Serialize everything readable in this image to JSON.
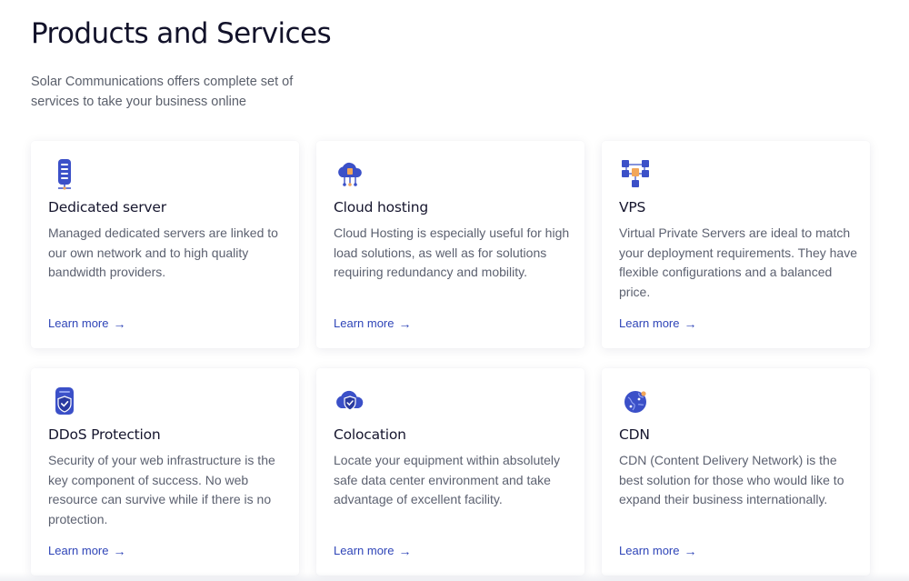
{
  "header": {
    "title": "Products and Services",
    "subtitle": "Solar Communications offers complete set of services to take your business online"
  },
  "colors": {
    "accent": "#2f45b8",
    "icon_primary": "#3b50c8",
    "icon_secondary": "#f2a65a"
  },
  "cards": [
    {
      "icon": "server-icon",
      "title": "Dedicated server",
      "description": "Managed dedicated servers are linked to our own network and to high quality bandwidth providers.",
      "link": "Learn more"
    },
    {
      "icon": "cloud-hosting-icon",
      "title": "Cloud hosting",
      "description": "Cloud Hosting is especially useful for high load solutions, as well as for solutions requiring redundancy and mobility.",
      "link": "Learn more"
    },
    {
      "icon": "network-nodes-icon",
      "title": "VPS",
      "description": "Virtual Private Servers are ideal to match your deployment requirements. They have flexible configurations and a balanced price.",
      "link": "Learn more"
    },
    {
      "icon": "shield-server-icon",
      "title": "DDoS Protection",
      "description": "Security of your web infrastructure is the key component of success. No web resource can survive while if there is no protection.",
      "link": "Learn more"
    },
    {
      "icon": "cloud-shield-icon",
      "title": "Colocation",
      "description": "Locate your equipment within absolutely safe data center environment and take advantage of excellent facility.",
      "link": "Learn more"
    },
    {
      "icon": "globe-icon",
      "title": "CDN",
      "description": "CDN (Content Delivery Network) is the best solution for those who would like to expand their business internationally.",
      "link": "Learn more"
    }
  ]
}
